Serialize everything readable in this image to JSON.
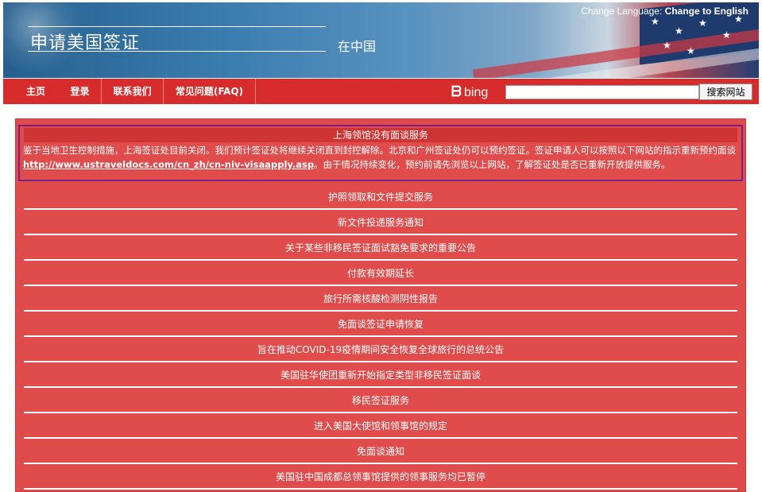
{
  "header": {
    "title": "申请美国签证",
    "subtitle": "在中国",
    "change_language_label": "Change Language:",
    "change_language_link": "Change to English"
  },
  "nav": {
    "items": [
      {
        "label": "主页"
      },
      {
        "label": "登录"
      },
      {
        "label": "联系我们"
      },
      {
        "label": "常见问题(FAQ)"
      }
    ],
    "bing_logo_text": "bing",
    "search_placeholder": "",
    "search_button_label": "搜索网站"
  },
  "alert": {
    "title": "上海领馆没有面谈服务",
    "body_part1": "鉴于当地卫生控制措施，上海签证处目前关闭。我们预计签证处将继续关闭直到封控解除。北京和广州签证处仍可以预约签证。签证申请人可以按照以下网站的指示重新预约面谈",
    "link_text": "http://www.ustraveldocs.com/cn_zh/cn-niv-visaapply.asp",
    "body_part2": "。由于情况持续变化，预约前请先浏览以上网站，了解签证处是否已重新开放提供服务。"
  },
  "notices": [
    {
      "label": "护照领取和文件提交服务"
    },
    {
      "label": "新文件投递服务通知"
    },
    {
      "label": "关于某些非移民签证面试豁免要求的重要公告"
    },
    {
      "label": "付款有效期延长"
    },
    {
      "label": "旅行所需核酸检测阴性报告"
    },
    {
      "label": "免面谈签证申请恢复"
    },
    {
      "label": "旨在推动COVID-19疫情期间安全恢复全球旅行的总统公告"
    },
    {
      "label": "美国驻华使团重新开始指定类型非移民签证面谈"
    },
    {
      "label": "移民签证服务"
    },
    {
      "label": "进入美国大使馆和领事馆的规定"
    },
    {
      "label": "免面谈通知"
    },
    {
      "label": "美国驻中国成都总领事馆提供的领事服务均已暂停"
    }
  ],
  "colors": {
    "nav_red": "#d82c2c",
    "panel_red": "#e04b4b",
    "alert_border": "#7a1f88",
    "banner_blue": "#3b7db0"
  }
}
